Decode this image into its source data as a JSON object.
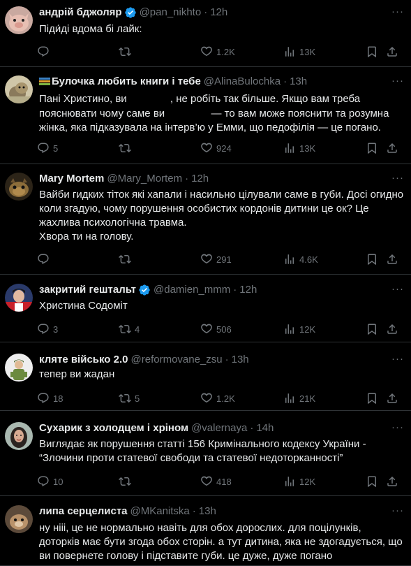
{
  "colors": {
    "background": "#000000",
    "text": "#e7e9ea",
    "muted": "#71767b",
    "divider": "#2f3336",
    "verified": "#1d9bf0"
  },
  "tweets": [
    {
      "name": "андрій бджоляр",
      "verified": true,
      "handle": "@pan_nikhto",
      "time": "12h",
      "avatar_icon": "avatar-pig-icon",
      "lines": [
        "Піди́ді вдома бі лайк:"
      ],
      "reply": "",
      "retweet": "",
      "like": "1.2K",
      "views": "13K"
    },
    {
      "name": "Булочка любить книги і тебе",
      "verified": false,
      "handle": "@AlinaBulochka",
      "time": "13h",
      "avatar_icon": "avatar-cat-icon",
      "lines": [
        "Пані Христино, ви [redacted], не робіть так більше. Якщо вам треба",
        "пояснювати чому саме ви [redacted] — то вам може пояснити та розумна",
        "жінка, яка підказувала на інтерв’ю у Емми, що педофілія — це погано."
      ],
      "reply": "5",
      "retweet": "",
      "like": "924",
      "views": "13K"
    },
    {
      "name": "Mary Mortem",
      "verified": false,
      "handle": "@Mary_Mortem",
      "time": "12h",
      "avatar_icon": "avatar-creature-icon",
      "lines": [
        "Вайби гидких тіток які хапали і насильно цілували саме в губи. Досі огидно",
        "коли згадую, чому порушення особистих кордонів дитини це ок? Це",
        "жахлива психологічна травма.",
        "Хвора ти на голову."
      ],
      "reply": "",
      "retweet": "",
      "like": "291",
      "views": "4.6K"
    },
    {
      "name": "закритий гештальт",
      "verified": true,
      "handle": "@damien_mmm",
      "time": "12h",
      "avatar_icon": "avatar-person-icon",
      "lines": [
        "Христина Содоміт"
      ],
      "reply": "3",
      "retweet": "4",
      "like": "506",
      "views": "12K"
    },
    {
      "name": "кляте військо 2.0",
      "verified": false,
      "handle": "@reformovane_zsu",
      "time": "13h",
      "avatar_icon": "avatar-soldier-icon",
      "lines": [
        "тепер ви жадан"
      ],
      "reply": "18",
      "retweet": "5",
      "like": "1.2K",
      "views": "21K"
    },
    {
      "name": "Сухарик з холодцем і хріном",
      "verified": false,
      "handle": "@valernaya",
      "time": "14h",
      "avatar_icon": "avatar-woman-icon",
      "lines": [
        "Виглядає як порушення статті 156 Кримінального кодексу України -",
        "“Злочини проти статевої свободи та статевої недоторканності”"
      ],
      "reply": "10",
      "retweet": "",
      "like": "418",
      "views": "12K"
    },
    {
      "name": "липа серцелиста",
      "verified": false,
      "handle": "@MKanitska",
      "time": "13h",
      "avatar_icon": "avatar-pet-icon",
      "lines": [
        "ну нііі, це не нормально навіть для обох дорослих. для поцілунків,",
        "доторків має бути згода обох сторін. а тут дитина, яка не здогадується, що",
        "ви повернете голову і підставите губи. це дуже, дуже погано"
      ],
      "reply": "",
      "retweet": "",
      "like": "",
      "views": ""
    }
  ],
  "more_label": "···"
}
